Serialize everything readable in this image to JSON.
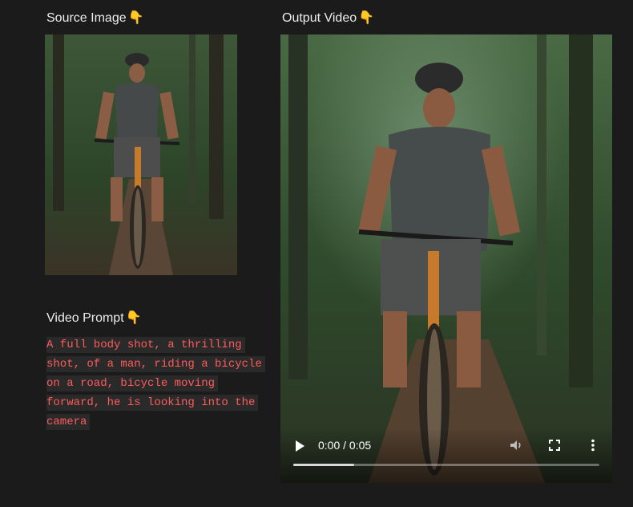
{
  "source": {
    "heading": "Source Image",
    "emoji": "👇",
    "image_alt": "man riding a mountain bicycle on a forest trail"
  },
  "output": {
    "heading": "Output Video",
    "emoji": "👇",
    "video_alt": "man riding a mountain bicycle on a forest trail",
    "current_time": "0:00 / 0:05",
    "progress_fraction": 0.2
  },
  "prompt": {
    "heading": "Video Prompt",
    "emoji": "👇",
    "text": "A full body shot, a thrilling shot, of a man, riding a bicycle on a road, bicycle moving forward, he is looking into the camera"
  },
  "icons": {
    "play": "play-icon",
    "mute": "volume-icon",
    "fullscreen": "fullscreen-icon",
    "more": "more-vert-icon"
  },
  "colors": {
    "background": "#1b1b1c",
    "prompt_text": "#ff5b5b",
    "prompt_bg": "#2a2a2a"
  }
}
